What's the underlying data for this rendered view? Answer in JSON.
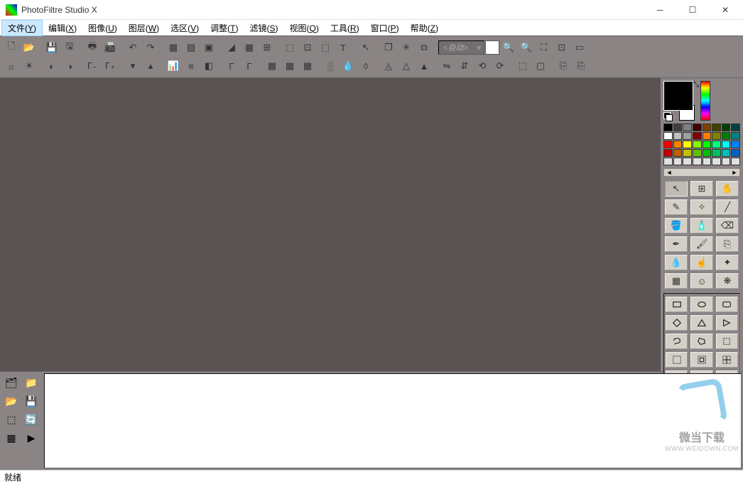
{
  "window": {
    "title": "PhotoFiltre Studio X"
  },
  "menu": {
    "items": [
      {
        "label": "文件",
        "accel": "Y"
      },
      {
        "label": "编辑",
        "accel": "X"
      },
      {
        "label": "图像",
        "accel": "U"
      },
      {
        "label": "图层",
        "accel": "W"
      },
      {
        "label": "选区",
        "accel": "V"
      },
      {
        "label": "调整",
        "accel": "T"
      },
      {
        "label": "滤镜",
        "accel": "S"
      },
      {
        "label": "视图",
        "accel": "Q"
      },
      {
        "label": "工具",
        "accel": "R"
      },
      {
        "label": "窗口",
        "accel": "P"
      },
      {
        "label": "帮助",
        "accel": "Z"
      }
    ],
    "active_index": 0
  },
  "toolbar": {
    "auto_label": "<自动>"
  },
  "colors": {
    "foreground": "#000000",
    "background": "#ffffff"
  },
  "palette_rows": [
    [
      "#000000",
      "#404040",
      "#808080",
      "#400000",
      "#804000",
      "#404000",
      "#004000",
      "#004040"
    ],
    [
      "#ffffff",
      "#c0c0c0",
      "#a0a0a0",
      "#800000",
      "#ff8000",
      "#808000",
      "#008000",
      "#008080"
    ],
    [
      "#ff0000",
      "#ff8000",
      "#ffff00",
      "#80ff00",
      "#00ff00",
      "#00ff80",
      "#00ffff",
      "#0080ff"
    ],
    [
      "#c00000",
      "#c06000",
      "#c0c000",
      "#60c000",
      "#00c000",
      "#00c060",
      "#00c0c0",
      "#0060c0"
    ],
    [
      "#e0e0e0",
      "#e0e0e0",
      "#e0e0e0",
      "#e0e0e0",
      "#e0e0e0",
      "#e0e0e0",
      "#e0e0e0",
      "#e0e0e0"
    ]
  ],
  "status": {
    "text": "就绪"
  },
  "watermark": {
    "text": "微当下载",
    "url": "WWW.WEIDOWN.COM"
  }
}
